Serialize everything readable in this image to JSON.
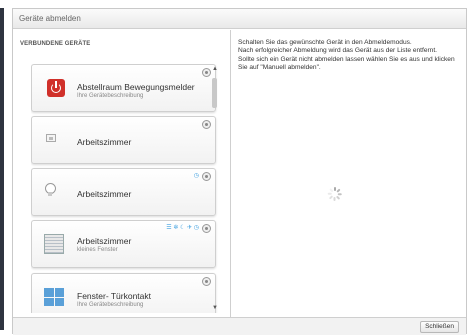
{
  "dialog": {
    "title": "Geräte abmelden",
    "section_title": "VERBUNDENE GERÄTE",
    "info_lines": [
      "Schalten Sie das gewünschte Gerät in den Abmeldemodus.",
      "Nach erfolgreicher Abmeldung wird das Gerät aus der Liste entfernt.",
      "Sollte sich ein Gerät nicht abmelden lassen wählen Sie es aus und klicken Sie auf \"Manuell abmelden\"."
    ],
    "close_label": "Schließen"
  },
  "devices": [
    {
      "name": "Abstellraum Bewegungsmelder",
      "description": "Ihre Gerätebeschreibung",
      "icon": "power-icon",
      "status_icons": ""
    },
    {
      "name": "Arbeitszimmer",
      "description": "",
      "icon": "room-icon",
      "status_icons": ""
    },
    {
      "name": "Arbeitszimmer",
      "description": "",
      "icon": "bulb-icon",
      "status_icons": "◷"
    },
    {
      "name": "Arbeitszimmer",
      "description": "kleines Fenster",
      "icon": "window-shutter-icon",
      "status_icons": "☰ ✲ ☾ ✈ ◷"
    },
    {
      "name": "Fenster- Türkontakt",
      "description": "Ihre Gerätebeschreibung",
      "icon": "window-tile-icon",
      "status_icons": ""
    }
  ],
  "colors": {
    "accent_red": "#d0302a",
    "accent_blue": "#3fa0e0"
  }
}
